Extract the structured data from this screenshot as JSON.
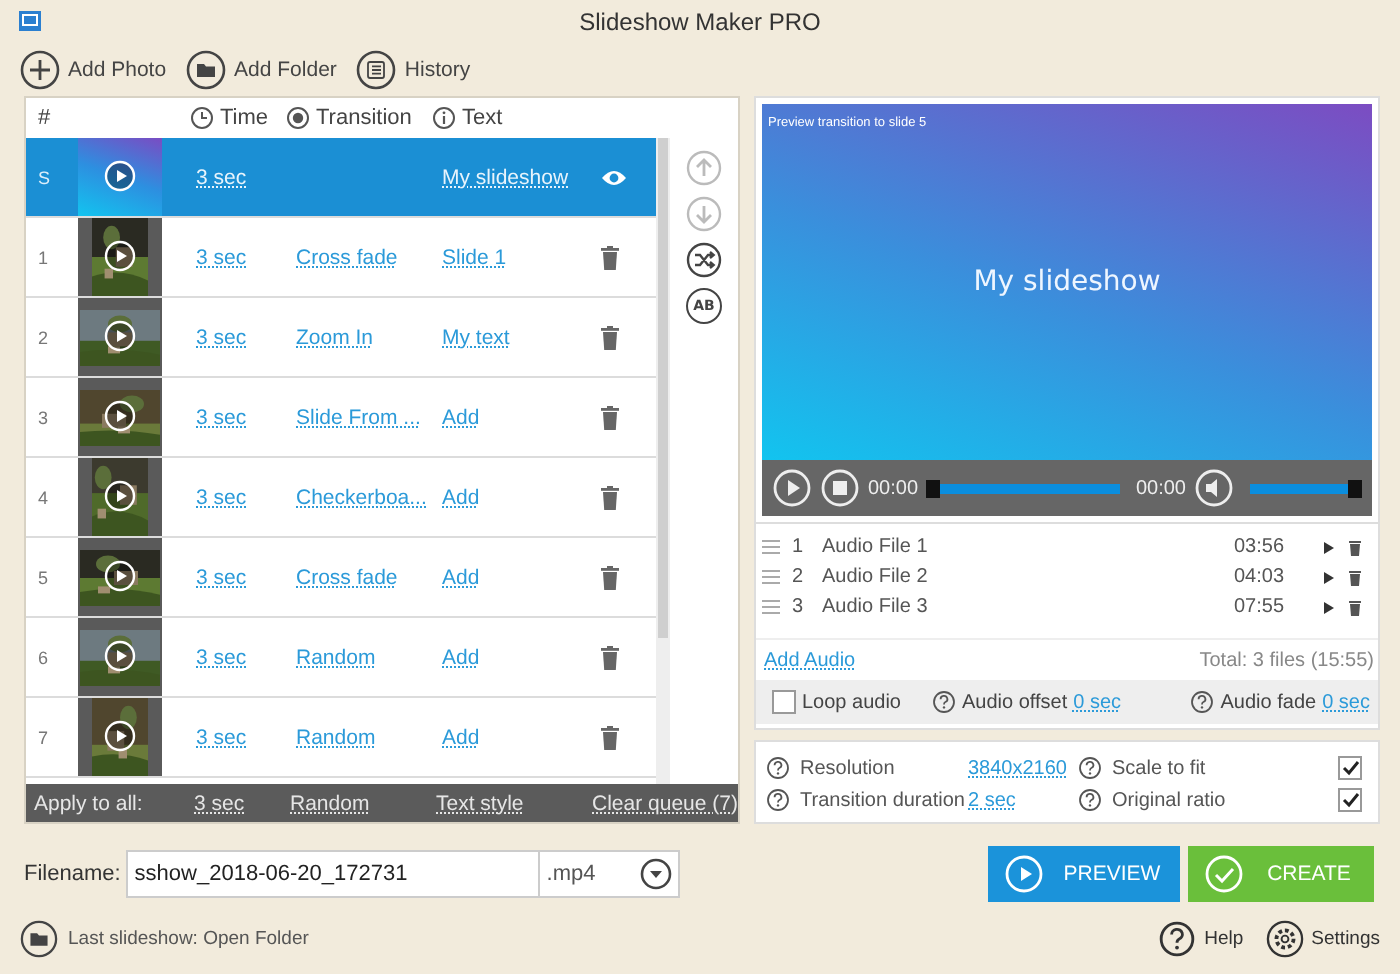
{
  "window": {
    "title": "Slideshow Maker PRO"
  },
  "toolbar": [
    {
      "kind": "add",
      "label": "Add Photo"
    },
    {
      "kind": "folder",
      "label": "Add Folder"
    },
    {
      "kind": "history",
      "label": "History"
    }
  ],
  "table": {
    "columns": [
      {
        "kind": "number",
        "label": "#"
      },
      {
        "kind": "time",
        "label": "Time"
      },
      {
        "kind": "transition",
        "label": "Transition"
      },
      {
        "kind": "text",
        "label": "Text"
      }
    ],
    "rows": [
      {
        "kind": "title",
        "number": "S",
        "time": "3 sec",
        "text": "My slideshow",
        "selected": true
      },
      {
        "number": "1",
        "time": "3 sec",
        "transition": "Cross fade",
        "text": "Slide 1",
        "selected": false
      },
      {
        "number": "2",
        "time": "3 sec",
        "transition": "Zoom In",
        "text": "My text",
        "selected": false
      },
      {
        "number": "3",
        "time": "3 sec",
        "transition": "Slide From ...",
        "text": "Add",
        "selected": false
      },
      {
        "number": "4",
        "time": "3 sec",
        "transition": "Checkerboa...",
        "text": "Add",
        "selected": false
      },
      {
        "number": "5",
        "time": "3 sec",
        "transition": "Cross fade",
        "text": "Add",
        "selected": false
      },
      {
        "number": "6",
        "time": "3 sec",
        "transition": "Random",
        "text": "Add",
        "selected": false
      },
      {
        "number": "7",
        "time": "3 sec",
        "transition": "Random",
        "text": "Add",
        "selected": false
      }
    ]
  },
  "side_tools": [
    {
      "kind": "up",
      "disabled": true
    },
    {
      "kind": "down",
      "disabled": true
    },
    {
      "kind": "shuffle",
      "disabled": false
    },
    {
      "kind": "text",
      "label": "AB",
      "disabled": false
    }
  ],
  "apply_bar": {
    "label": "Apply to all:",
    "time": "3 sec",
    "transition": "Random",
    "text_style": "Text style",
    "clear": "Clear queue (7)"
  },
  "preview": {
    "caption": "Preview transition to slide 5",
    "title": "My slideshow",
    "current_time": "00:00",
    "total_time": "00:00",
    "seek": {
      "level": 0
    },
    "volume": {
      "level": 1
    }
  },
  "audio": {
    "files": [
      {
        "number": "1",
        "name": "Audio File 1",
        "duration": "03:56"
      },
      {
        "number": "2",
        "name": "Audio File 2",
        "duration": "04:03"
      },
      {
        "number": "3",
        "name": "Audio File 3",
        "duration": "07:55"
      }
    ],
    "add_label": "Add Audio",
    "total": "Total: 3 files (15:55)",
    "loop": {
      "label": "Loop audio",
      "checked": false
    },
    "offset": {
      "label": "Audio offset",
      "value": "0 sec"
    },
    "fade": {
      "label": "Audio fade",
      "value": "0 sec"
    }
  },
  "settings": {
    "fields": [
      {
        "label": "Resolution",
        "value": "3840x2160"
      },
      {
        "label": "Transition duration",
        "value": "2 sec"
      }
    ],
    "options": [
      {
        "label": "Scale to fit",
        "checked": true
      },
      {
        "label": "Original ratio",
        "checked": true
      }
    ]
  },
  "filename": {
    "label": "Filename:",
    "value": "sshow_2018-06-20_172731",
    "extension": ".mp4"
  },
  "buttons": [
    {
      "kind": "preview",
      "label": "PREVIEW"
    },
    {
      "kind": "create",
      "label": "CREATE"
    }
  ],
  "footer": {
    "last": "Last slideshow: Open Folder",
    "links": [
      {
        "kind": "help",
        "label": "Help"
      },
      {
        "kind": "settings",
        "label": "Settings"
      }
    ]
  }
}
